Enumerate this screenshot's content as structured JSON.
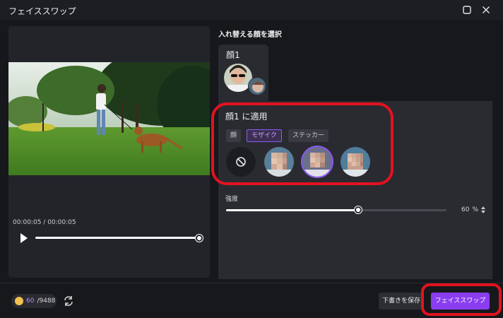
{
  "window": {
    "title": "フェイススワップ",
    "maximize_icon": "maximize-icon",
    "close_icon": "close-icon"
  },
  "player": {
    "time_current": "00:00:05",
    "time_separator": " / ",
    "time_total": "00:00:05",
    "progress": 1.0
  },
  "faces": {
    "section_title": "入れ替える顔を選択",
    "items": [
      {
        "label": "顔1"
      }
    ]
  },
  "apply": {
    "title": "顔1 に適用",
    "tabs": [
      {
        "label": "顔",
        "active": false
      },
      {
        "label": "モザイク",
        "active": true
      },
      {
        "label": "ステッカー",
        "active": false
      }
    ],
    "options": [
      {
        "icon": "no-effect-icon",
        "selected": false
      },
      {
        "icon": "mosaic-face-1",
        "selected": false
      },
      {
        "icon": "mosaic-face-2",
        "selected": true
      },
      {
        "icon": "mosaic-face-3",
        "selected": false
      }
    ]
  },
  "strength": {
    "label": "強度",
    "value": 60,
    "unit": "%"
  },
  "footer": {
    "credits_used": "60",
    "credits_total": "/9488",
    "draft_button": "下書きを保存",
    "swap_button": "フェイススワップ"
  },
  "colors": {
    "accent": "#8a3df0",
    "annotation": "#e3121f"
  }
}
